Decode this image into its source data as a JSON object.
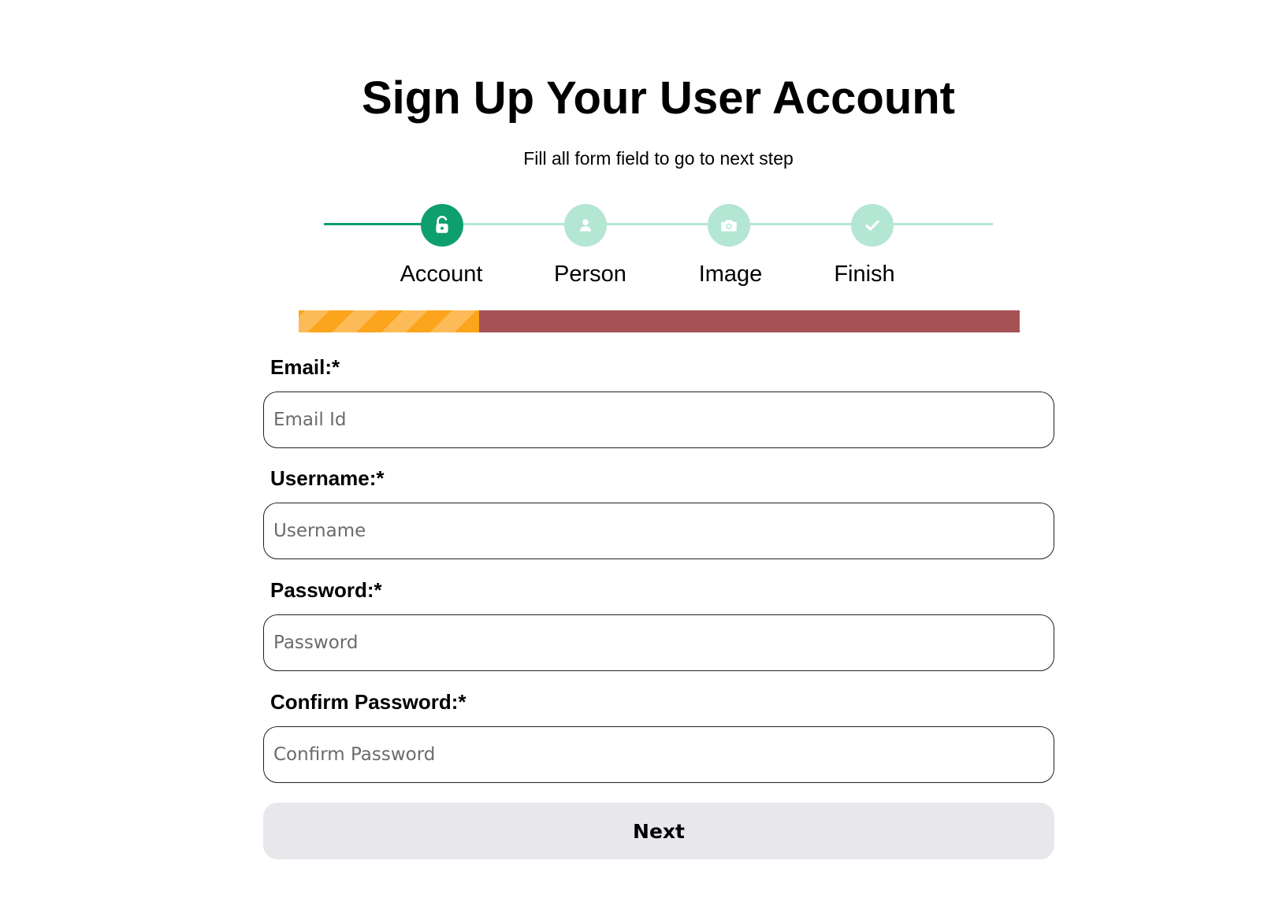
{
  "header": {
    "title": "Sign Up Your User Account",
    "subtitle": "Fill all form field to go to next step"
  },
  "stepper": {
    "steps": [
      {
        "label": "Account",
        "icon": "unlock-icon",
        "active": true
      },
      {
        "label": "Person",
        "icon": "user-icon",
        "active": false
      },
      {
        "label": "Image",
        "icon": "camera-icon",
        "active": false
      },
      {
        "label": "Finish",
        "icon": "check-icon",
        "active": false
      }
    ],
    "colors": {
      "active": "#0e9f6e",
      "inactive": "#b3e6d3"
    }
  },
  "progress": {
    "percent": 25,
    "colors": {
      "fill": "#fba41c",
      "stripe": "#fdbb57",
      "track": "#a65255"
    }
  },
  "form": {
    "email": {
      "label": "Email:*",
      "placeholder": "Email Id"
    },
    "username": {
      "label": "Username:*",
      "placeholder": "Username"
    },
    "password": {
      "label": "Password:*",
      "placeholder": "Password"
    },
    "confirm_password": {
      "label": "Confirm Password:*",
      "placeholder": "Confirm Password"
    },
    "next_label": "Next"
  }
}
